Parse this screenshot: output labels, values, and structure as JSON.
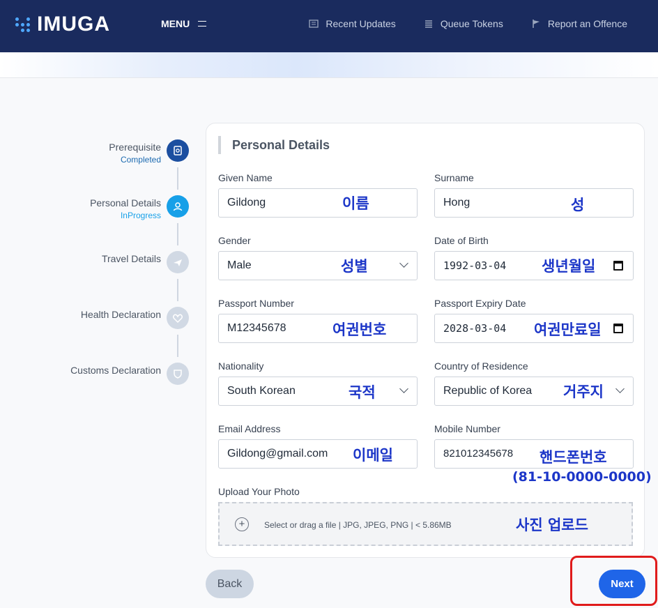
{
  "brand": {
    "name": "IMUGA"
  },
  "nav": {
    "menu_label": "MENU",
    "links": [
      "Recent Updates",
      "Queue Tokens",
      "Report an Offence"
    ]
  },
  "stepper": {
    "steps": [
      {
        "label": "Prerequisite",
        "status": "Completed"
      },
      {
        "label": "Personal Details",
        "status": "InProgress"
      },
      {
        "label": "Travel Details",
        "status": ""
      },
      {
        "label": "Health Declaration",
        "status": ""
      },
      {
        "label": "Customs Declaration",
        "status": ""
      }
    ]
  },
  "form": {
    "title": "Personal Details",
    "fields": {
      "given_name": {
        "label": "Given Name",
        "value": "Gildong"
      },
      "surname": {
        "label": "Surname",
        "value": "Hong"
      },
      "gender": {
        "label": "Gender",
        "value": "Male"
      },
      "dob": {
        "label": "Date of Birth",
        "value": "1992-03-04"
      },
      "passport_number": {
        "label": "Passport Number",
        "value": "M12345678"
      },
      "passport_expiry": {
        "label": "Passport Expiry Date",
        "value": "2028-03-04"
      },
      "nationality": {
        "label": "Nationality",
        "value": "South Korean"
      },
      "residence": {
        "label": "Country of Residence",
        "value": "Republic of Korea"
      },
      "email": {
        "label": "Email Address",
        "value": "Gildong@gmail.com"
      },
      "mobile": {
        "label": "Mobile Number",
        "value": "821012345678"
      }
    },
    "upload": {
      "label": "Upload Your Photo",
      "hint": "Select or drag a file | JPG, JPEG, PNG | < 5.86MB"
    }
  },
  "annotations": {
    "given_name": "이름",
    "surname": "성",
    "gender": "성별",
    "dob": "생년월일",
    "passport_number": "여권번호",
    "passport_expiry": "여권만료일",
    "nationality": "국적",
    "residence": "거주지",
    "email": "이메일",
    "mobile": "핸드폰번호",
    "mobile_format": "(81-10-0000-0000)",
    "photo": "사진 업로드"
  },
  "buttons": {
    "back": "Back",
    "next": "Next"
  },
  "colors": {
    "header": "#1a2b5e",
    "completed": "#1c4fa0",
    "in_progress": "#17a0e8",
    "annotation": "#1c36c8",
    "next": "#1f65e8",
    "highlight": "#e01b1b"
  }
}
